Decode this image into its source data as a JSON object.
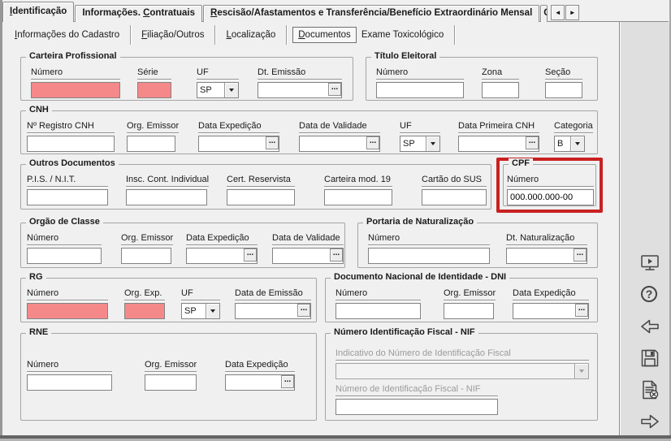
{
  "colors": {
    "field_pink": "#f58989",
    "highlight_red": "#c92121",
    "sidebar_gray": "#dfdfdf",
    "window_gray": "#f0f0f0"
  },
  "ui": {
    "ellipsis": "...",
    "help_glyph": "?",
    "scroll_left": "◄",
    "scroll_right": "►",
    "clipped_tab": "C"
  },
  "tabs_main": {
    "items": [
      {
        "pre": "",
        "key": "I",
        "post": "dentificação",
        "active": true
      },
      {
        "pre": "Informações. ",
        "key": "C",
        "post": "ontratuais",
        "active": false
      },
      {
        "pre": "",
        "key": "R",
        "post": "escisão/Afastamentos e Transferência/Benefício Extraordinário Mensal",
        "active": false
      }
    ]
  },
  "tabs_sub": {
    "items": [
      {
        "pre": "",
        "key": "I",
        "post": "nformações do Cadastro",
        "selected": false
      },
      {
        "pre": "",
        "key": "F",
        "post": "iliação/Outros",
        "selected": false
      },
      {
        "pre": "",
        "key": "L",
        "post": "ocalização",
        "selected": false
      },
      {
        "pre": "",
        "key": "D",
        "post": "ocumentos",
        "selected": true
      },
      {
        "pre": "",
        "key": "",
        "post": "Exame Toxicológico",
        "selected": false
      }
    ]
  },
  "groups": {
    "carteira": {
      "title": "Carteira Profissional",
      "f_numero": "Número",
      "numero_value": "",
      "f_serie": "Série",
      "serie_value": "",
      "f_uf": "UF",
      "uf_value": "SP",
      "f_dt_emissao": "Dt. Emissão",
      "dt_emissao_value": ""
    },
    "titulo": {
      "title": "Título Eleitoral",
      "f_numero": "Número",
      "numero_value": "",
      "f_zona": "Zona",
      "zona_value": "",
      "f_secao": "Seção",
      "secao_value": ""
    },
    "cnh": {
      "title": "CNH",
      "f_registro": "Nº Registro CNH",
      "registro_value": "",
      "f_org_emissor": "Org. Emissor",
      "org_emissor_value": "",
      "f_data_expedicao": "Data Expedição",
      "data_expedicao_value": "",
      "f_data_validade": "Data de Validade",
      "data_validade_value": "",
      "f_uf": "UF",
      "uf_value": "SP",
      "f_data_primeira": "Data Primeira CNH",
      "data_primeira_value": "",
      "f_categoria": "Categoria",
      "categoria_value": "B"
    },
    "outros": {
      "title": "Outros Documentos",
      "f_pis": "P.I.S. / N.I.T.",
      "pis_value": "",
      "f_insc": "Insc. Cont. Individual",
      "insc_value": "",
      "f_cert": "Cert. Reservista",
      "cert_value": "",
      "f_cart19": "Carteira mod. 19",
      "cart19_value": "",
      "f_sus": "Cartão do SUS",
      "sus_value": ""
    },
    "cpf": {
      "title": "CPF",
      "f_numero": "Número",
      "numero_value": "000.000.000-00"
    },
    "orgao": {
      "title": "Orgão de Classe",
      "f_numero": "Número",
      "numero_value": "",
      "f_org_emissor": "Org. Emissor",
      "org_emissor_value": "",
      "f_data_expedicao": "Data Expedição",
      "data_expedicao_value": "",
      "f_data_validade": "Data de Validade",
      "data_validade_value": ""
    },
    "portaria": {
      "title": "Portaria de Naturalização",
      "f_numero": "Número",
      "numero_value": "",
      "f_dt_naturalizacao": "Dt. Naturalização",
      "dt_naturalizacao_value": ""
    },
    "rg": {
      "title": "RG",
      "f_numero": "Número",
      "numero_value": "",
      "f_org_exp": "Org. Exp.",
      "org_exp_value": "",
      "f_uf": "UF",
      "uf_value": "SP",
      "f_data_emissao": "Data de Emissão",
      "data_emissao_value": ""
    },
    "dni": {
      "title": "Documento Nacional de Identidade - DNI",
      "f_numero": "Número",
      "numero_value": "",
      "f_org_emissor": "Org. Emissor",
      "org_emissor_value": "",
      "f_data_expedicao": "Data Expedição",
      "data_expedicao_value": ""
    },
    "rne": {
      "title": "RNE",
      "f_numero": "Número",
      "numero_value": "",
      "f_org_emissor": "Org. Emissor",
      "org_emissor_value": "",
      "f_data_expedicao": "Data Expedição",
      "data_expedicao_value": ""
    },
    "nif": {
      "title": "Número Identificação Fiscal - NIF",
      "f_indicativo": "Indicativo do Número de Identificação Fiscal",
      "indicativo_value": "",
      "f_numero": "Número de Identificação Fiscal - NIF",
      "numero_value": ""
    }
  },
  "sidebar": {
    "icons": [
      "screen-preview",
      "help",
      "navigate-previous",
      "save",
      "delete-record",
      "navigate-next"
    ]
  }
}
